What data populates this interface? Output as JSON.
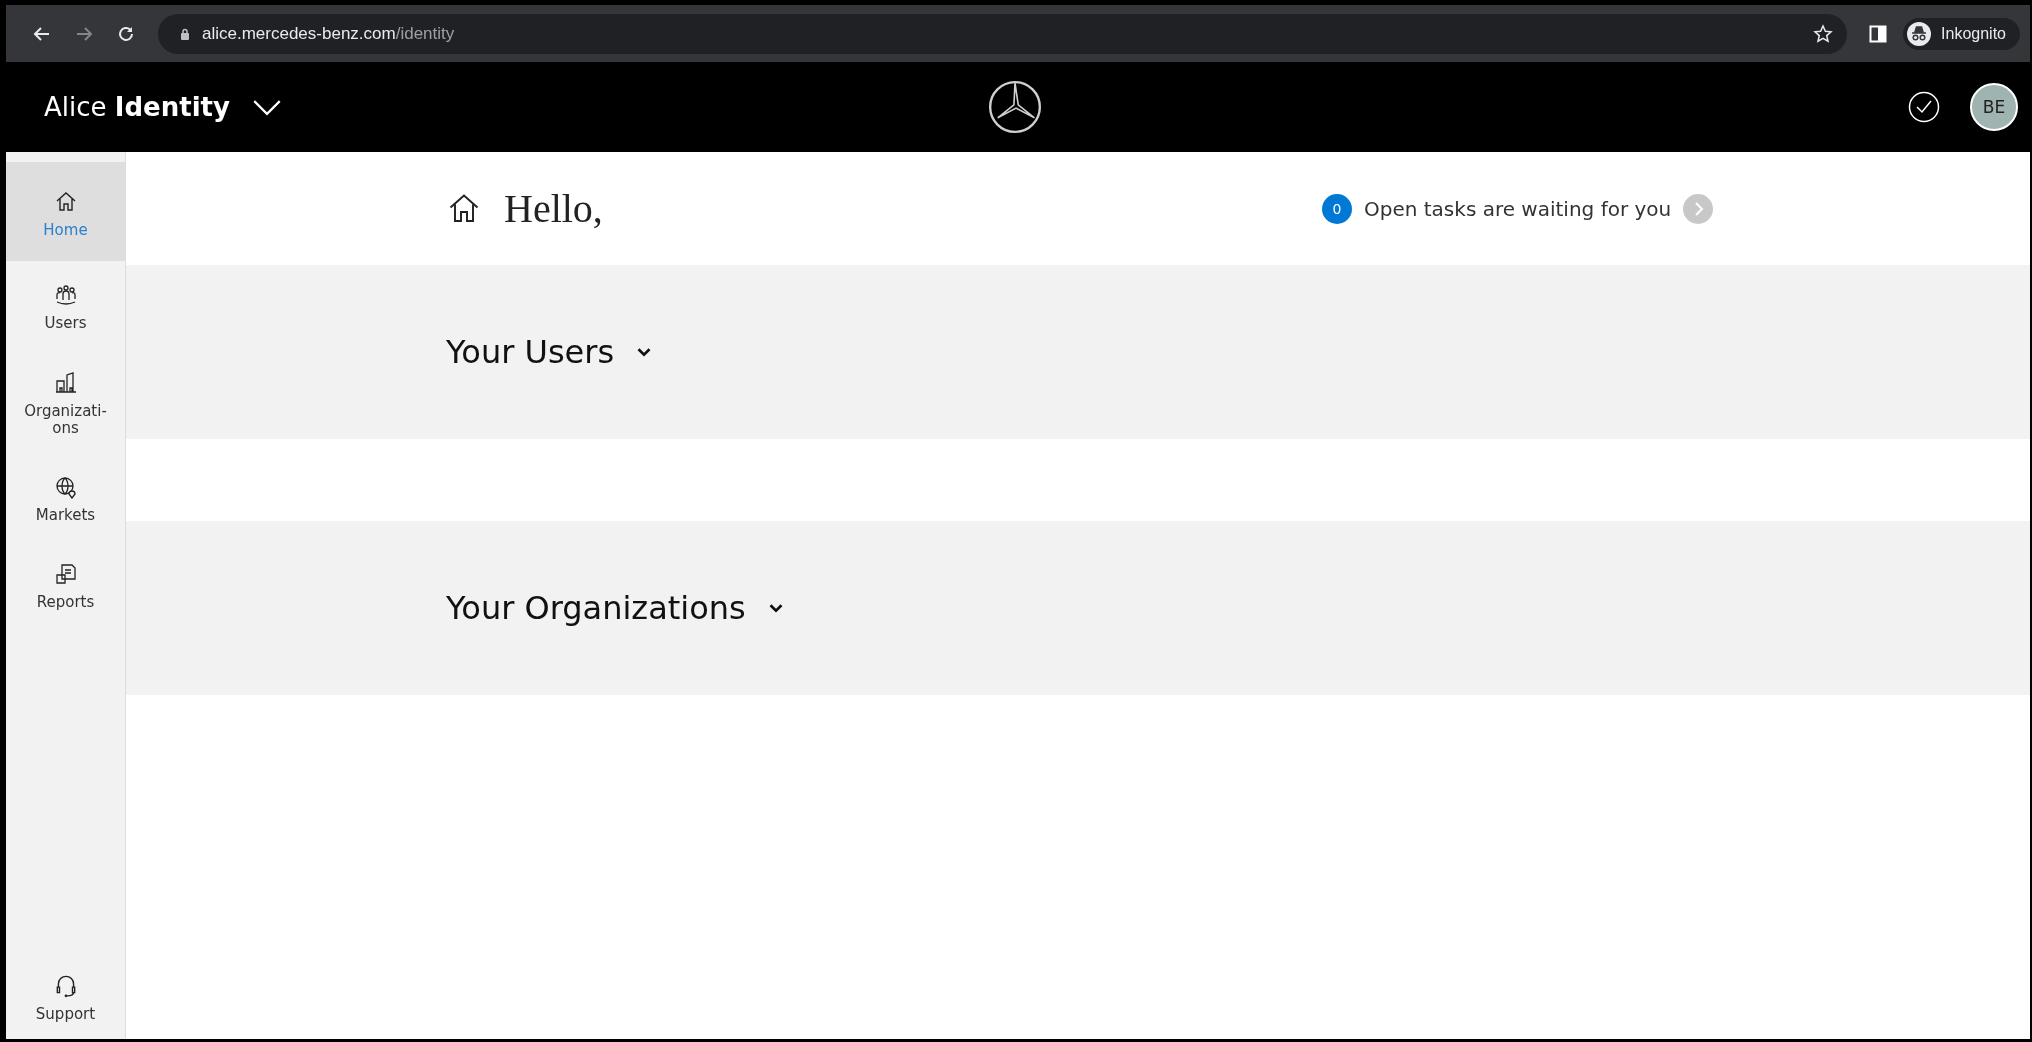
{
  "browser": {
    "url_host": "alice.mercedes-benz.com",
    "url_path": "/identity",
    "profile": "Inkognito"
  },
  "header": {
    "app_title": "Alice **Identity**",
    "avatar": "BE"
  },
  "sidebar": {
    "items": [
      {
        "label": "Home",
        "selected": true
      },
      {
        "label": "Users",
        "selected": false
      },
      {
        "label": "Organizati-\nons",
        "selected": false
      },
      {
        "label": "Markets",
        "selected": false
      },
      {
        "label": "Reports",
        "selected": false
      }
    ],
    "footer_item": {
      "label": "Support"
    }
  },
  "greeting": "Hello,",
  "tasks": {
    "count": "0",
    "text": "Open tasks are waiting for you"
  },
  "sections": [
    {
      "title": "Your Users"
    },
    {
      "title": "Your Organizations"
    }
  ]
}
